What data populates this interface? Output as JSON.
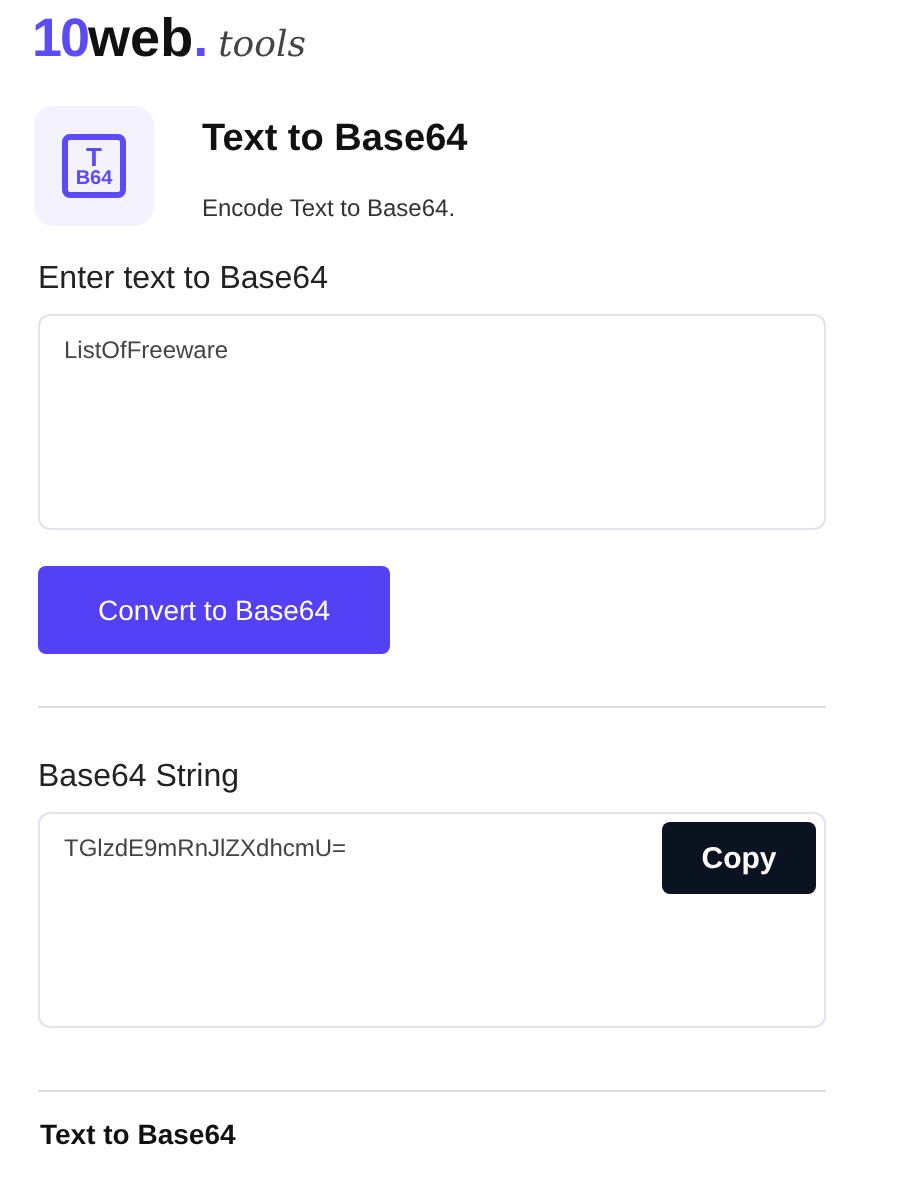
{
  "logo": {
    "number": "10",
    "word": "web",
    "dot": ".",
    "suffix": "tools"
  },
  "tool": {
    "icon_top": "T",
    "icon_bottom": "B64",
    "title": "Text to Base64",
    "subtitle": "Encode Text to Base64."
  },
  "input": {
    "label": "Enter text to Base64",
    "value": "ListOfFreeware"
  },
  "convert_button": "Convert to Base64",
  "output": {
    "label": "Base64 String",
    "value": "TGlzdE9mRnJlZXdhcmU=",
    "copy_button": "Copy"
  },
  "footer_heading": "Text to Base64"
}
